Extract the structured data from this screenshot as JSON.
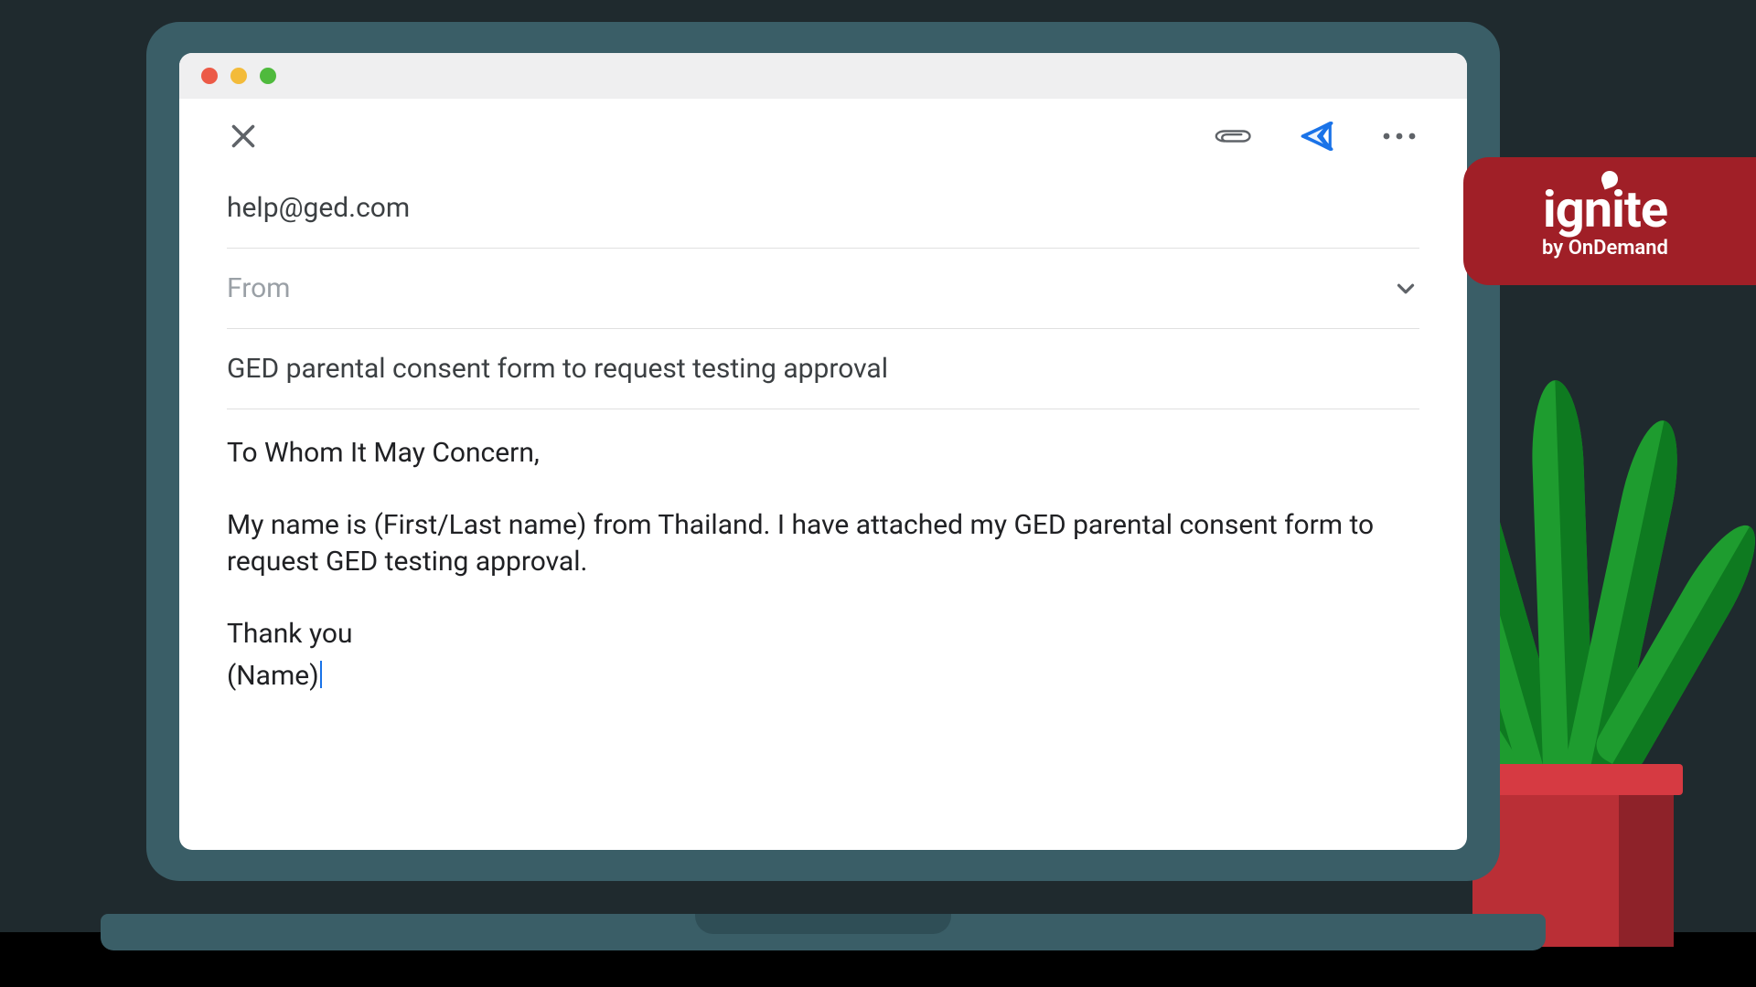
{
  "badge": {
    "brand": "ignite",
    "sub": "by OnDemand"
  },
  "email": {
    "to": "help@ged.com",
    "from_label": "From",
    "subject": "GED parental consent form to request testing approval",
    "body": {
      "greeting": "To Whom It May Concern,",
      "paragraph": "My name is (First/Last name) from Thailand. I have attached my GED parental consent form to request GED testing approval.",
      "closing": "Thank you",
      "signature": "(Name)"
    }
  },
  "icons": {
    "close": "close-icon",
    "attach": "paperclip-icon",
    "send": "send-icon",
    "more": "more-icon",
    "chevron": "chevron-down-icon"
  }
}
